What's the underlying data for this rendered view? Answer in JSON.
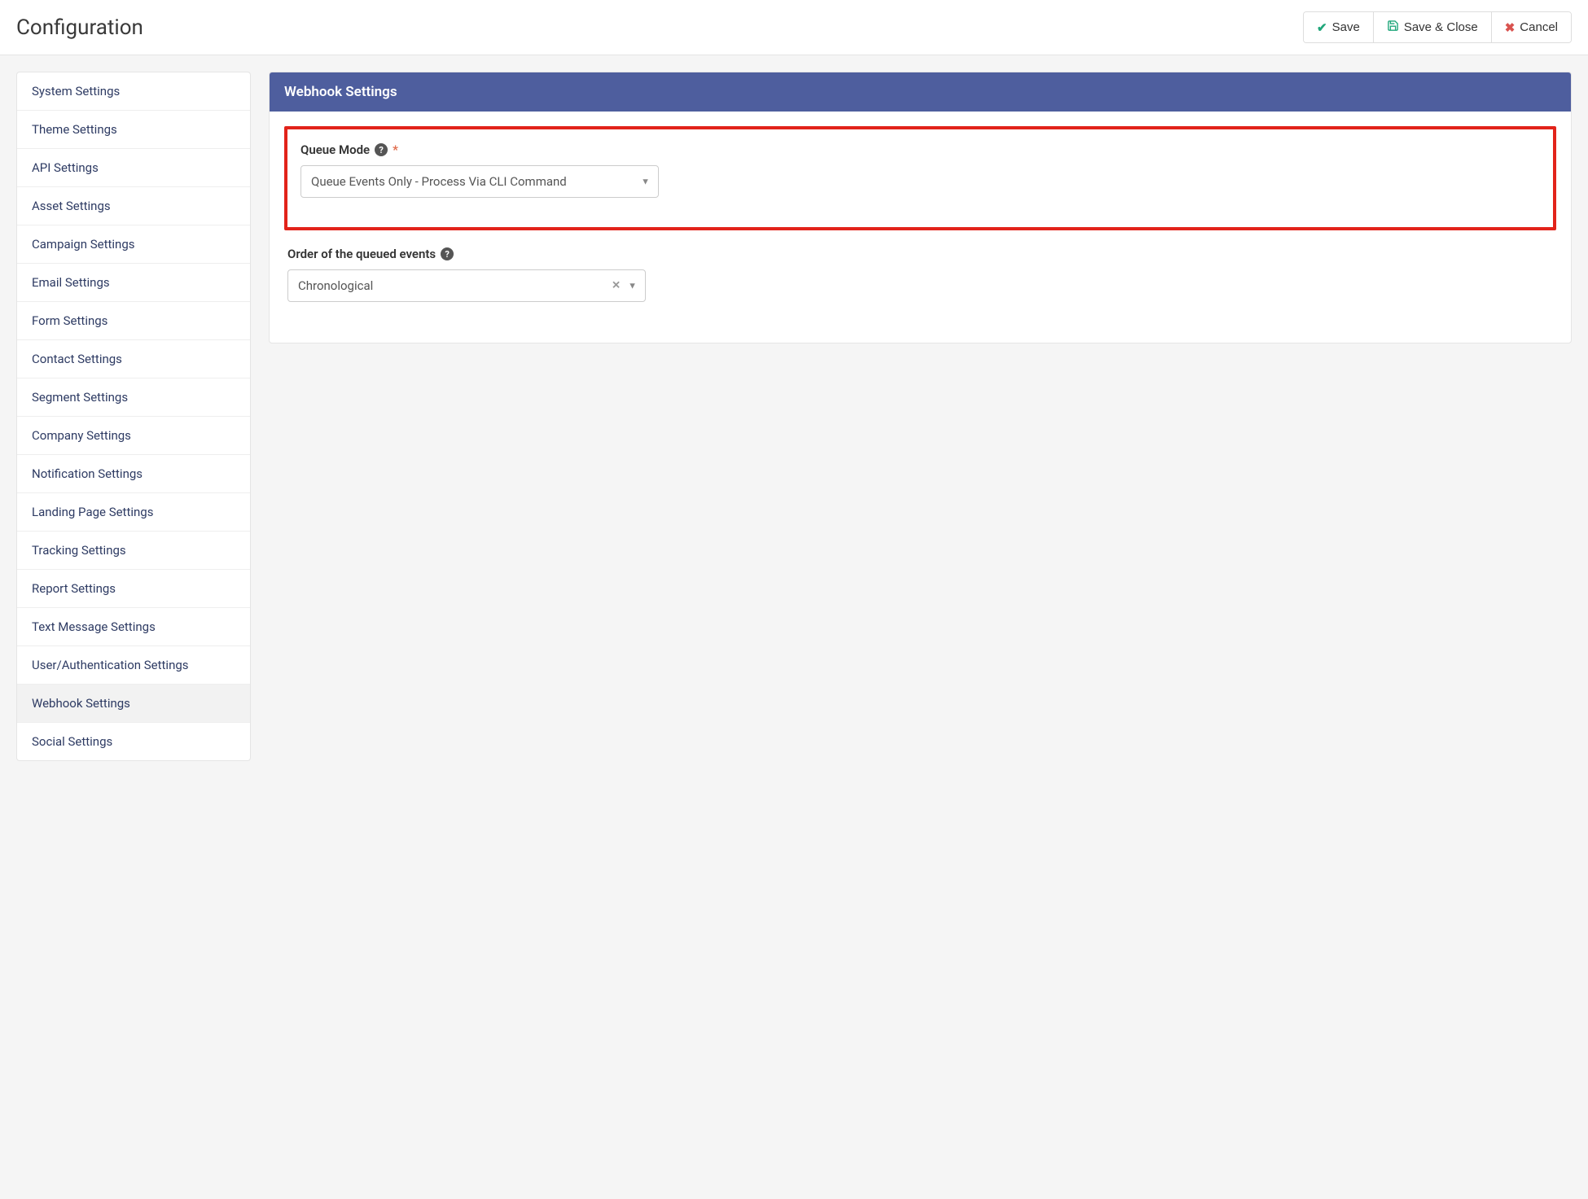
{
  "header": {
    "title": "Configuration",
    "buttons": {
      "save": "Save",
      "save_close": "Save & Close",
      "cancel": "Cancel"
    }
  },
  "sidebar": {
    "items": [
      "System Settings",
      "Theme Settings",
      "API Settings",
      "Asset Settings",
      "Campaign Settings",
      "Email Settings",
      "Form Settings",
      "Contact Settings",
      "Segment Settings",
      "Company Settings",
      "Notification Settings",
      "Landing Page Settings",
      "Tracking Settings",
      "Report Settings",
      "Text Message Settings",
      "User/Authentication Settings",
      "Webhook Settings",
      "Social Settings"
    ],
    "active_index": 16
  },
  "panel": {
    "title": "Webhook Settings",
    "fields": {
      "queue_mode": {
        "label": "Queue Mode",
        "required": true,
        "value": "Queue Events Only - Process Via CLI Command"
      },
      "order": {
        "label": "Order of the queued events",
        "required": false,
        "value": "Chronological"
      }
    }
  },
  "glyphs": {
    "help": "?",
    "asterisk": "*",
    "caret": "▼",
    "clear": "✕",
    "check": "✔",
    "close": "✖"
  }
}
